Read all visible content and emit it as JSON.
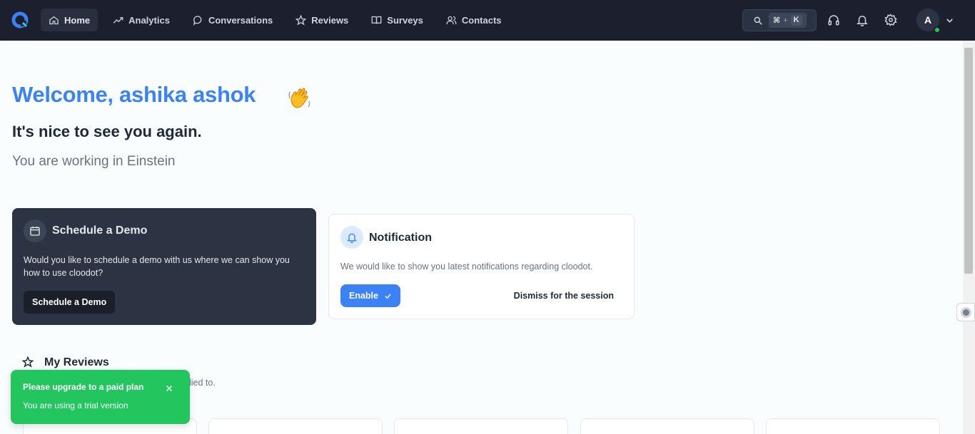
{
  "nav": {
    "items": [
      {
        "label": "Home",
        "icon": "home-icon"
      },
      {
        "label": "Analytics",
        "icon": "trending-up-icon"
      },
      {
        "label": "Conversations",
        "icon": "chat-bubble-icon"
      },
      {
        "label": "Reviews",
        "icon": "star-icon"
      },
      {
        "label": "Surveys",
        "icon": "book-open-icon"
      },
      {
        "label": "Contacts",
        "icon": "users-icon"
      }
    ],
    "active": "Home",
    "search_shortcut_mod": "⌘",
    "search_shortcut_plus": "+",
    "search_shortcut_key": "K",
    "avatar_initial": "A"
  },
  "welcome": {
    "title": "Welcome, ashika ashok",
    "subtitle": "It's nice to see you again.",
    "workspace": "You are working in Einstein"
  },
  "demo_card": {
    "title": "Schedule a Demo",
    "text": "Would you like to schedule a demo with us where we can show you how to use cloodot?",
    "button": "Schedule a Demo"
  },
  "notification_card": {
    "title": "Notification",
    "text": "We would like to show you latest notifications regarding cloodot.",
    "enable_button": "Enable",
    "dismiss_button": "Dismiss for the session"
  },
  "reviews": {
    "title": "My Reviews",
    "subtitle_visible": "plied to."
  },
  "toast": {
    "title": "Please upgrade to a paid plan",
    "text": "You are using a trial version"
  },
  "colors": {
    "nav_bg": "#1b1f2e",
    "accent": "#3b82f6",
    "demo_card_bg": "#2c3443",
    "toast_bg": "#22c55e",
    "status_online": "#22c55e"
  }
}
